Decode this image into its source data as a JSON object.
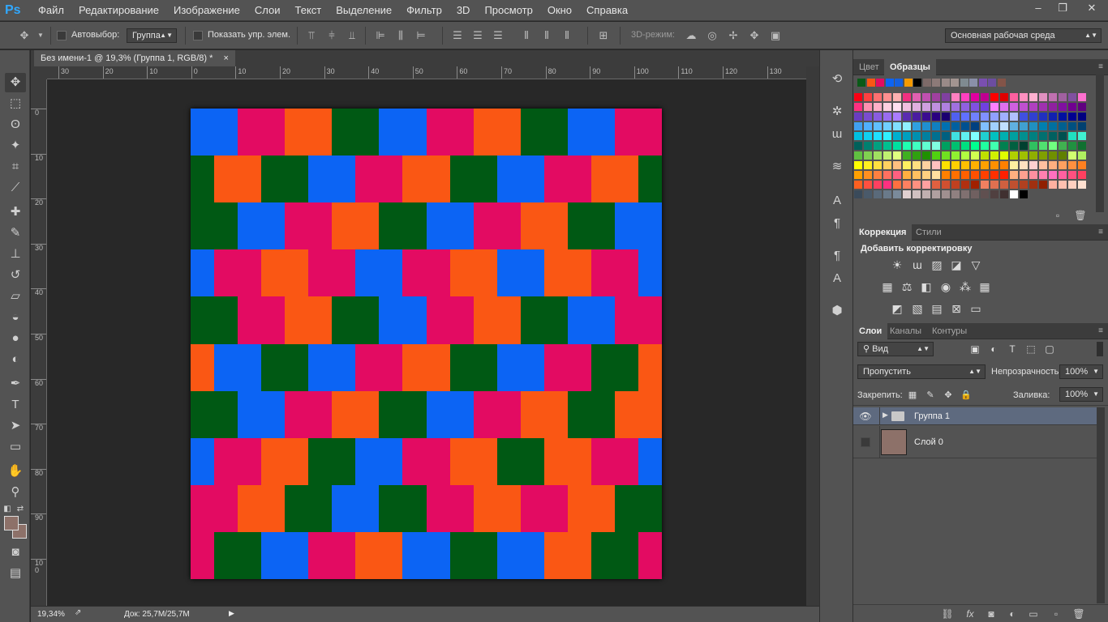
{
  "app": {
    "logo": "Ps"
  },
  "menu": [
    "Файл",
    "Редактирование",
    "Изображение",
    "Слои",
    "Текст",
    "Выделение",
    "Фильтр",
    "3D",
    "Просмотр",
    "Окно",
    "Справка"
  ],
  "window_controls": {
    "minimize": "–",
    "restore": "❐",
    "close": "✕"
  },
  "options_bar": {
    "autoselect_label": "Автовыбор:",
    "autoselect_value": "Группа",
    "show_transform_label": "Показать упр. элем.",
    "mode_3d_label": "3D-режим:",
    "workspace_value": "Основная рабочая среда"
  },
  "document": {
    "tab_title": "Без имени-1 @ 19,3% (Группа 1, RGB/8) *",
    "tab_close": "×",
    "zoom": "19,34%",
    "doc_size": "Док: 25,7M/25,7M"
  },
  "rulers": {
    "horizontal": [
      "30",
      "20",
      "10",
      "0",
      "10",
      "20",
      "30",
      "40",
      "50",
      "60",
      "70",
      "80",
      "90",
      "100",
      "110",
      "120",
      "130"
    ],
    "vertical": [
      "0",
      "10",
      "20",
      "30",
      "40",
      "50",
      "60",
      "70",
      "80",
      "90",
      "100"
    ]
  },
  "artwork": {
    "colors": {
      "B": "#0c64f4",
      "M": "#e30b62",
      "O": "#fa5714",
      "G": "#005914"
    },
    "rows": [
      {
        "offset": 0,
        "cells": [
          "B",
          "M",
          "O",
          "G",
          "B",
          "M",
          "O",
          "G",
          "B",
          "M"
        ]
      },
      {
        "offset": 0.5,
        "cells": [
          "G",
          "O",
          "G",
          "B",
          "M",
          "O",
          "G",
          "B",
          "M",
          "O",
          "G"
        ]
      },
      {
        "offset": 0,
        "cells": [
          "G",
          "B",
          "M",
          "O",
          "G",
          "B",
          "M",
          "O",
          "G",
          "B"
        ]
      },
      {
        "offset": 0.5,
        "cells": [
          "B",
          "M",
          "O",
          "M",
          "B",
          "M",
          "O",
          "B",
          "O",
          "M",
          "B"
        ]
      },
      {
        "offset": 0,
        "cells": [
          "G",
          "M",
          "O",
          "G",
          "B",
          "M",
          "O",
          "G",
          "B",
          "M"
        ]
      },
      {
        "offset": 0.5,
        "cells": [
          "O",
          "B",
          "G",
          "B",
          "M",
          "O",
          "G",
          "B",
          "M",
          "G",
          "O"
        ]
      },
      {
        "offset": 0,
        "cells": [
          "G",
          "B",
          "M",
          "O",
          "G",
          "B",
          "M",
          "O",
          "G",
          "O"
        ]
      },
      {
        "offset": 0.5,
        "cells": [
          "B",
          "M",
          "O",
          "G",
          "B",
          "M",
          "O",
          "G",
          "O",
          "M",
          "B"
        ]
      },
      {
        "offset": 0,
        "cells": [
          "M",
          "O",
          "G",
          "B",
          "G",
          "M",
          "O",
          "M",
          "O",
          "G"
        ]
      },
      {
        "offset": 0.5,
        "cells": [
          "M",
          "G",
          "B",
          "M",
          "O",
          "B",
          "G",
          "B",
          "O",
          "G",
          "M"
        ]
      }
    ]
  },
  "tools": [
    {
      "name": "move-tool-icon",
      "glyph": "✥",
      "active": true
    },
    {
      "name": "marquee-tool-icon",
      "glyph": "⬚"
    },
    {
      "name": "lasso-tool-icon",
      "glyph": "ʘ"
    },
    {
      "name": "magic-wand-tool-icon",
      "glyph": "✦"
    },
    {
      "name": "crop-tool-icon",
      "glyph": "⌗"
    },
    {
      "name": "eyedropper-tool-icon",
      "glyph": "⟋"
    },
    {
      "name": "healing-brush-tool-icon",
      "glyph": "✚"
    },
    {
      "name": "brush-tool-icon",
      "glyph": "✎"
    },
    {
      "name": "stamp-tool-icon",
      "glyph": "⊥"
    },
    {
      "name": "history-brush-tool-icon",
      "glyph": "↺"
    },
    {
      "name": "eraser-tool-icon",
      "glyph": "▱"
    },
    {
      "name": "paint-bucket-tool-icon",
      "glyph": "◒"
    },
    {
      "name": "blur-tool-icon",
      "glyph": "●"
    },
    {
      "name": "dodge-tool-icon",
      "glyph": "◐"
    },
    {
      "name": "pen-tool-icon",
      "glyph": "✒"
    },
    {
      "name": "type-tool-icon",
      "glyph": "T"
    },
    {
      "name": "path-selection-tool-icon",
      "glyph": "➤"
    },
    {
      "name": "rectangle-tool-icon",
      "glyph": "▭"
    },
    {
      "name": "hand-tool-icon",
      "glyph": "✋"
    },
    {
      "name": "zoom-tool-icon",
      "glyph": "⚲"
    }
  ],
  "foreground_color": "#8d7169",
  "background_color": "#8d7169",
  "swatches_panel": {
    "tabs": [
      "Цвет",
      "Образцы"
    ],
    "recent": [
      "#0a5a18",
      "#fa5714",
      "#e30b62",
      "#0c64f4",
      "#1460e0",
      "#f59a00",
      "#000000",
      "#7d6a68",
      "#8c7a78",
      "#9a8a88",
      "#a29490",
      "#7f8a90",
      "#8a8fa8",
      "#7a4fb0",
      "#6c4da0",
      "#835448"
    ],
    "grid": [
      [
        "#fa0014",
        "#ff4040",
        "#ff7070",
        "#ff9090",
        "#ffb0b0",
        "#f03080",
        "#e060b0",
        "#c050b0",
        "#a040a0",
        "#8040a0",
        "#ff80c0",
        "#ff40c0",
        "#e000a0",
        "#c00090",
        "#ff0000",
        "#e00000",
        "#ff60a0",
        "#ff90c0",
        "#ffb0d0",
        "#e090c0",
        "#c070b0",
        "#a060a0",
        "#8050a0",
        "#ff70d0"
      ],
      [
        "#ff3080",
        "#ff90b0",
        "#ffb0c8",
        "#ffd0e0",
        "#ffe0f0",
        "#f0c0e0",
        "#e0b0e0",
        "#d0a0e0",
        "#c090e0",
        "#b080e0",
        "#a070e0",
        "#9060e0",
        "#8050e0",
        "#7040e0",
        "#ff80ff",
        "#e070f0",
        "#d060e0",
        "#c050d0",
        "#b040c0",
        "#a030b0",
        "#9020a0",
        "#8010a0",
        "#700090",
        "#600080"
      ],
      [
        "#6a3cc0",
        "#7a4cd0",
        "#8a5ce0",
        "#9a6cf0",
        "#aa7cff",
        "#5a2cb0",
        "#4a1ca0",
        "#3a0c90",
        "#2a0080",
        "#1a0070",
        "#5060f0",
        "#6070ff",
        "#7080ff",
        "#8090ff",
        "#90a0ff",
        "#a0b0ff",
        "#b0c0ff",
        "#4050e0",
        "#3040d0",
        "#2030c0",
        "#1020b0",
        "#0010a0",
        "#000090",
        "#000080"
      ],
      [
        "#40a0f0",
        "#50b0ff",
        "#60c0ff",
        "#70d0ff",
        "#80e0ff",
        "#90f0ff",
        "#30a0e0",
        "#2090d0",
        "#1080c0",
        "#0070b0",
        "#0060a0",
        "#005090",
        "#004080",
        "#80c0ff",
        "#a0d0ff",
        "#c0e0ff",
        "#60b0e0",
        "#40a0d0",
        "#2090c0",
        "#0080b0",
        "#0070a0",
        "#006090",
        "#005080",
        "#004070"
      ],
      [
        "#00c0e0",
        "#10d0f0",
        "#20e0ff",
        "#30f0ff",
        "#00b0d0",
        "#00a0c0",
        "#0090b0",
        "#0080a0",
        "#007090",
        "#006080",
        "#40e0e0",
        "#60f0f0",
        "#80ffff",
        "#20d0d0",
        "#00c0c0",
        "#00b0b0",
        "#00a0a0",
        "#009090",
        "#008080",
        "#007070",
        "#006060",
        "#005050",
        "#20e0c0",
        "#40f0d0"
      ],
      [
        "#00605a",
        "#008070",
        "#00a080",
        "#00c090",
        "#00e0a0",
        "#20ffb0",
        "#40ffc0",
        "#60ffd0",
        "#80ffe0",
        "#00a060",
        "#00c070",
        "#00e080",
        "#00ff90",
        "#20ffa0",
        "#40ffb0",
        "#008050",
        "#006040",
        "#004030",
        "#30c060",
        "#50e070",
        "#70ff80",
        "#40b050",
        "#209040",
        "#107030"
      ],
      [
        "#60c040",
        "#80d050",
        "#a0e060",
        "#c0f070",
        "#e0ff80",
        "#40b020",
        "#30a010",
        "#209000",
        "#50d010",
        "#70e020",
        "#90f030",
        "#b0ff40",
        "#d0ff50",
        "#c0e000",
        "#d0f000",
        "#e0ff00",
        "#b0d000",
        "#a0c000",
        "#90b000",
        "#80a000",
        "#709000",
        "#608000",
        "#d0ff70",
        "#b0f060"
      ],
      [
        "#ffff00",
        "#fff020",
        "#ffe040",
        "#ffd060",
        "#ffc080",
        "#fff060",
        "#ffe080",
        "#ffd0a0",
        "#ffc0c0",
        "#ffe000",
        "#ffd000",
        "#ffc000",
        "#ffb000",
        "#ffa000",
        "#ff9000",
        "#ff8000",
        "#fff0a0",
        "#ffe0c0",
        "#ffd0d0",
        "#ffc0a0",
        "#ffb080",
        "#ffa060",
        "#ff9040",
        "#ff8020"
      ],
      [
        "#ffa000",
        "#ff9020",
        "#ff8040",
        "#ff7060",
        "#ff6080",
        "#ffb040",
        "#ffc060",
        "#ffd080",
        "#ffe0a0",
        "#ff8000",
        "#ff7000",
        "#ff6000",
        "#ff5000",
        "#ff4000",
        "#ff3000",
        "#ff2000",
        "#ffb080",
        "#ffa090",
        "#ff90a0",
        "#ff80b0",
        "#ff70c0",
        "#ff60a0",
        "#ff5080",
        "#ff4060"
      ],
      [
        "#ff6020",
        "#ff5040",
        "#ff4060",
        "#ff3080",
        "#ff7040",
        "#ff8060",
        "#ff9080",
        "#ffa0a0",
        "#e06040",
        "#d05030",
        "#c04020",
        "#b03010",
        "#a02000",
        "#f08060",
        "#e07050",
        "#d06040",
        "#c05030",
        "#b04020",
        "#a03010",
        "#902000",
        "#ffb0a0",
        "#ffc0b0",
        "#ffd0c0",
        "#ffe0d0"
      ],
      [
        "#3a4a5a",
        "#4a5a6a",
        "#5a6a7a",
        "#6a7a8a",
        "#7a8a9a",
        "#e0d0d0",
        "#d0c0c0",
        "#c0b0b0",
        "#b0a0a0",
        "#a09090",
        "#908080",
        "#807070",
        "#706060",
        "#605050",
        "#504040",
        "#403030",
        "#ffffff",
        "#000000"
      ]
    ]
  },
  "adjustments_panel": {
    "tabs": [
      "Коррекция",
      "Стили"
    ],
    "heading": "Добавить корректировку",
    "row1": [
      "brightness-icon",
      "levels-icon",
      "curves-icon",
      "exposure-icon",
      "vibrance-icon"
    ],
    "row2": [
      "hue-saturation-icon",
      "color-balance-icon",
      "black-white-icon",
      "photo-filter-icon",
      "channel-mixer-icon",
      "color-lookup-icon"
    ],
    "row3": [
      "invert-icon",
      "posterize-icon",
      "threshold-icon",
      "selective-color-icon",
      "gradient-map-icon"
    ]
  },
  "layers_panel": {
    "tabs": [
      "Слои",
      "Каналы",
      "Контуры"
    ],
    "filter_value": "Вид",
    "blend_mode": "Пропустить",
    "opacity_label": "Непрозрачность:",
    "opacity_value": "100%",
    "lock_label": "Закрепить:",
    "fill_label": "Заливка:",
    "fill_value": "100%",
    "layers": [
      {
        "name": "Группа 1",
        "type": "group",
        "visible": true,
        "selected": true
      },
      {
        "name": "Слой 0",
        "type": "layer",
        "visible": false,
        "selected": false,
        "thumb": "#8d7169"
      }
    ]
  },
  "colors": {
    "panel_bg": "#535353",
    "dark_bg": "#282828",
    "selected_layer": "#5e6a7f",
    "accent": "#31a8ff"
  }
}
